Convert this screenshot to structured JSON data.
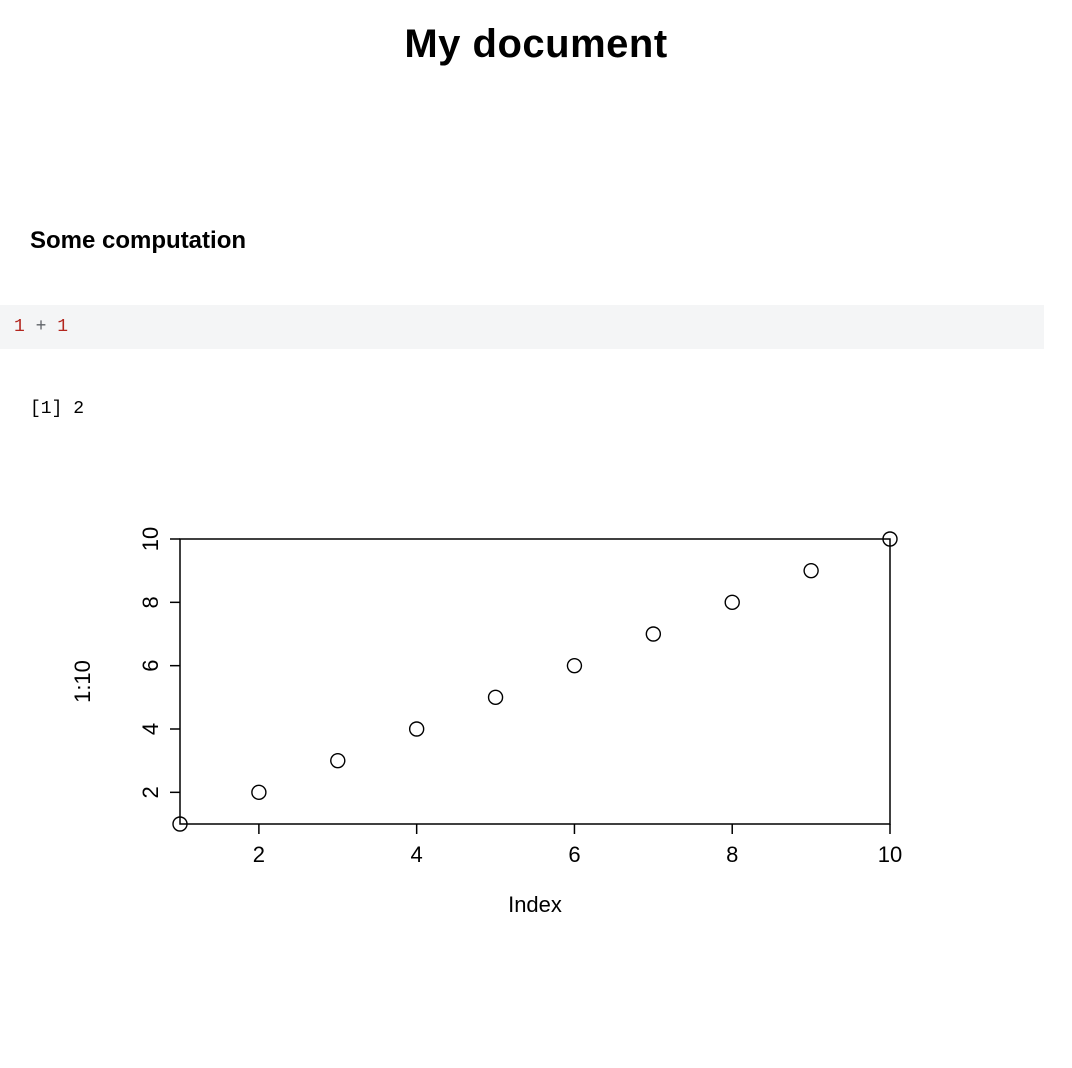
{
  "title": "My document",
  "section_heading": "Some computation",
  "code": {
    "tokens": [
      "1",
      " + ",
      "1"
    ],
    "token_classes": [
      "tok-num",
      "tok-op",
      "tok-num"
    ]
  },
  "output": "[1] 2",
  "chart_data": {
    "type": "scatter",
    "x": [
      1,
      2,
      3,
      4,
      5,
      6,
      7,
      8,
      9,
      10
    ],
    "y": [
      1,
      2,
      3,
      4,
      5,
      6,
      7,
      8,
      9,
      10
    ],
    "xlabel": "Index",
    "ylabel": "1:10",
    "xlim": [
      1,
      10
    ],
    "ylim": [
      1,
      10
    ],
    "xticks": [
      2,
      4,
      6,
      8,
      10
    ],
    "yticks": [
      2,
      4,
      6,
      8,
      10
    ]
  }
}
